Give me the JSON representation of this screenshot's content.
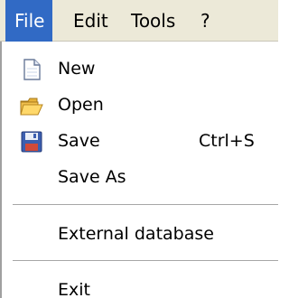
{
  "menubar": {
    "items": [
      {
        "label": "File",
        "active": true
      },
      {
        "label": "Edit"
      },
      {
        "label": "Tools"
      },
      {
        "label": "?"
      }
    ]
  },
  "dropdown": {
    "items": [
      {
        "label": "New",
        "icon": "new-document-icon"
      },
      {
        "label": "Open",
        "icon": "open-folder-icon"
      },
      {
        "label": "Save",
        "icon": "floppy-disk-icon",
        "shortcut": "Ctrl+S"
      },
      {
        "label": "Save As"
      },
      {
        "label": "External database"
      },
      {
        "label": "Exit"
      }
    ]
  },
  "colors": {
    "highlight": "#316ac5",
    "menubar_bg": "#ece9d8",
    "separator": "#a7a7a7"
  }
}
